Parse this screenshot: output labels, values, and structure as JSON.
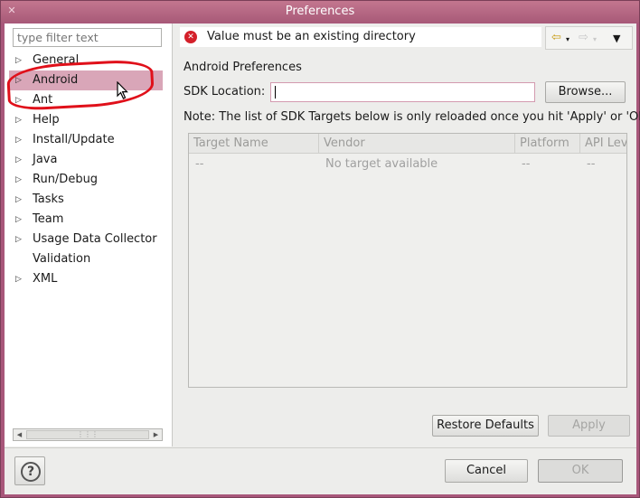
{
  "window": {
    "title": "Preferences"
  },
  "filter": {
    "placeholder": "type filter text"
  },
  "tree": {
    "items": [
      {
        "label": "General",
        "has_arrow": true
      },
      {
        "label": "Android",
        "has_arrow": true,
        "selected": true
      },
      {
        "label": "Ant",
        "has_arrow": true
      },
      {
        "label": "Help",
        "has_arrow": true
      },
      {
        "label": "Install/Update",
        "has_arrow": true
      },
      {
        "label": "Java",
        "has_arrow": true
      },
      {
        "label": "Run/Debug",
        "has_arrow": true
      },
      {
        "label": "Tasks",
        "has_arrow": true
      },
      {
        "label": "Team",
        "has_arrow": true
      },
      {
        "label": "Usage Data Collector",
        "has_arrow": true
      },
      {
        "label": "Validation",
        "has_arrow": false
      },
      {
        "label": "XML",
        "has_arrow": true
      }
    ]
  },
  "message": {
    "text": "Value must be an existing directory"
  },
  "page": {
    "section_title": "Android Preferences",
    "sdk_label": "SDK Location:",
    "sdk_value": "",
    "browse_label": "Browse...",
    "note": "Note: The list of SDK Targets below is only reloaded once you hit 'Apply' or 'OK'."
  },
  "table": {
    "columns": [
      "Target Name",
      "Vendor",
      "Platform",
      "API Lev"
    ],
    "rows": [
      [
        "--",
        "No target available",
        "--",
        "--"
      ]
    ]
  },
  "buttons": {
    "restore_defaults": "Restore Defaults",
    "apply": "Apply",
    "cancel": "Cancel",
    "ok": "OK"
  },
  "colors": {
    "title_bar": "#a85a78",
    "selection": "#d9a6b8",
    "annotation_circle": "#e0101a",
    "error_icon": "#d4202a"
  }
}
